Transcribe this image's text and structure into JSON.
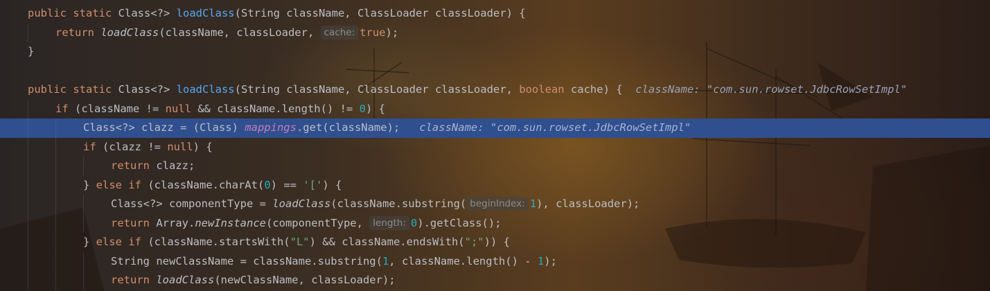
{
  "editor": {
    "language": "java",
    "colors": {
      "keyword": "#cf8e6d",
      "function": "#56a8f5",
      "field": "#c77dbb",
      "string": "#6aab73",
      "number": "#2aacb8",
      "text": "#bcbec4",
      "current_line": "#2f4f8f"
    },
    "current_line_index": 6,
    "lines": [
      {
        "indent": 1,
        "tokens": [
          {
            "t": "public static ",
            "c": "kw"
          },
          {
            "t": "Class<?> "
          },
          {
            "t": "loadClass",
            "c": "fn"
          },
          {
            "t": "(String className, ClassLoader classLoader) {"
          }
        ]
      },
      {
        "indent": 2,
        "tokens": [
          {
            "t": "return ",
            "c": "kw"
          },
          {
            "t": "loadClass",
            "c": "fn-i"
          },
          {
            "t": "(className, classLoader, "
          },
          {
            "t": "cache:",
            "c": "hint"
          },
          {
            "t": "true",
            "c": "kw"
          },
          {
            "t": ");"
          }
        ]
      },
      {
        "indent": 1,
        "tokens": [
          {
            "t": "}"
          }
        ]
      },
      {
        "indent": 0,
        "tokens": []
      },
      {
        "indent": 1,
        "tokens": [
          {
            "t": "public static ",
            "c": "kw"
          },
          {
            "t": "Class<?> "
          },
          {
            "t": "loadClass",
            "c": "fn"
          },
          {
            "t": "(String className, ClassLoader classLoader, "
          },
          {
            "t": "boolean ",
            "c": "kw"
          },
          {
            "t": "cache) {  "
          },
          {
            "t": "className: \"com.sun.rowset.JdbcRowSetImpl\"",
            "c": "inline-val"
          }
        ]
      },
      {
        "indent": 2,
        "tokens": [
          {
            "t": "if ",
            "c": "kw"
          },
          {
            "t": "(className != "
          },
          {
            "t": "null",
            "c": "kw"
          },
          {
            "t": " && className.length() != "
          },
          {
            "t": "0",
            "c": "num"
          },
          {
            "t": ") {"
          }
        ]
      },
      {
        "indent": 3,
        "tokens": [
          {
            "t": "Class<?> clazz = (Class) "
          },
          {
            "t": "mappings",
            "c": "field-i"
          },
          {
            "t": ".get(className);   "
          },
          {
            "t": "className: \"com.sun.rowset.JdbcRowSetImpl\"",
            "c": "inline-val"
          }
        ]
      },
      {
        "indent": 3,
        "tokens": [
          {
            "t": "if ",
            "c": "kw"
          },
          {
            "t": "(clazz != "
          },
          {
            "t": "null",
            "c": "kw"
          },
          {
            "t": ") {"
          }
        ]
      },
      {
        "indent": 4,
        "tokens": [
          {
            "t": "return ",
            "c": "kw"
          },
          {
            "t": "clazz;"
          }
        ]
      },
      {
        "indent": 3,
        "tokens": [
          {
            "t": "} "
          },
          {
            "t": "else if ",
            "c": "kw"
          },
          {
            "t": "(className.charAt("
          },
          {
            "t": "0",
            "c": "num"
          },
          {
            "t": ") == "
          },
          {
            "t": "'['",
            "c": "str"
          },
          {
            "t": ") {"
          }
        ]
      },
      {
        "indent": 4,
        "tokens": [
          {
            "t": "Class<?> componentType = "
          },
          {
            "t": "loadClass",
            "c": "fn-i"
          },
          {
            "t": "(className.substring("
          },
          {
            "t": "beginIndex:",
            "c": "hint"
          },
          {
            "t": "1",
            "c": "num"
          },
          {
            "t": "), classLoader);"
          }
        ]
      },
      {
        "indent": 4,
        "tokens": [
          {
            "t": "return ",
            "c": "kw"
          },
          {
            "t": "Array."
          },
          {
            "t": "newInstance",
            "c": "fn-i"
          },
          {
            "t": "(componentType, "
          },
          {
            "t": "length:",
            "c": "hint"
          },
          {
            "t": "0",
            "c": "num"
          },
          {
            "t": ").getClass();"
          }
        ]
      },
      {
        "indent": 3,
        "tokens": [
          {
            "t": "} "
          },
          {
            "t": "else if ",
            "c": "kw"
          },
          {
            "t": "(className.startsWith("
          },
          {
            "t": "\"L\"",
            "c": "str"
          },
          {
            "t": ") && className.endsWith("
          },
          {
            "t": "\";\"",
            "c": "str"
          },
          {
            "t": ")) {"
          }
        ]
      },
      {
        "indent": 4,
        "tokens": [
          {
            "t": "String newClassName = className.substring("
          },
          {
            "t": "1",
            "c": "num"
          },
          {
            "t": ", className.length() - "
          },
          {
            "t": "1",
            "c": "num"
          },
          {
            "t": ");"
          }
        ]
      },
      {
        "indent": 4,
        "tokens": [
          {
            "t": "return ",
            "c": "kw"
          },
          {
            "t": "loadClass",
            "c": "fn-i"
          },
          {
            "t": "(newClassName, classLoader);"
          }
        ]
      }
    ]
  }
}
